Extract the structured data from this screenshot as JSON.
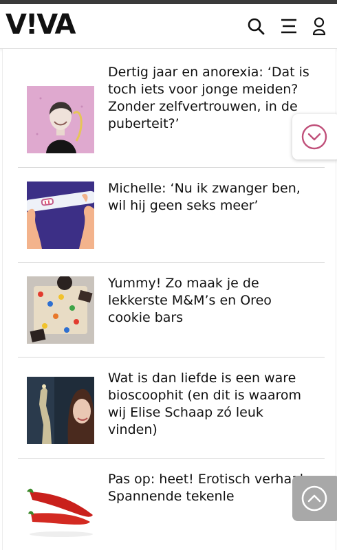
{
  "header": {
    "logo_text": "V!VA",
    "icons": [
      "search-icon",
      "menu-icon",
      "user-icon"
    ]
  },
  "articles": [
    {
      "title": "Dertig jaar en anorexia: ‘Dat is toch iets voor jonge meiden? Zonder zelfvertrouwen, in de puberteit?’",
      "thumb": "portrait-woman"
    },
    {
      "title": "Michelle: ‘Nu ik zwanger ben, wil hij geen seks meer’",
      "thumb": "pregnancy-test"
    },
    {
      "title": "Yummy! Zo maak je de lekkerste M&M’s en Oreo cookie bars",
      "thumb": "cookie-bars"
    },
    {
      "title": "Wat is dan liefde is een ware bioscoophit (en dit is waarom wij Elise Schaap zó leuk vinden)",
      "thumb": "actress-giraffe"
    },
    {
      "title": "Pas op: heet! Erotisch verhaal: Spannende tekenle",
      "thumb": "red-peppers"
    }
  ],
  "colors": {
    "accent": "#c0507a",
    "scroll_top_bg": "#a8a8a8",
    "divider": "#d6d6d6"
  },
  "floating": {
    "scroll_down_icon": "chevron-down-icon",
    "scroll_top_icon": "chevron-up-icon"
  }
}
